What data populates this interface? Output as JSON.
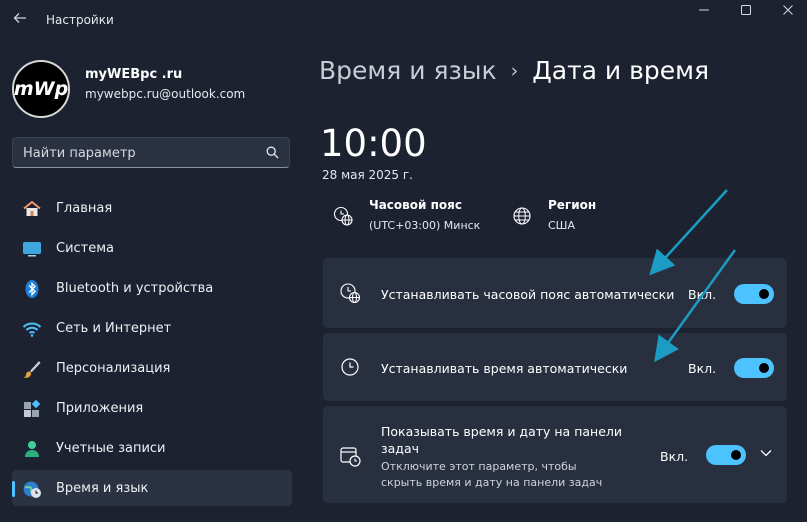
{
  "window": {
    "title": "Настройки",
    "controls": [
      "minimize-icon",
      "maximize-icon",
      "close-icon"
    ]
  },
  "profile": {
    "avatar_text": "mWp",
    "name": "myWEBpc .ru",
    "email": "mywebpc.ru@outlook.com"
  },
  "search": {
    "placeholder": "Найти параметр"
  },
  "sidebar": {
    "items": [
      {
        "label": "Главная",
        "icon": "home-icon",
        "active": false
      },
      {
        "label": "Система",
        "icon": "system-icon",
        "active": false
      },
      {
        "label": "Bluetooth и устройства",
        "icon": "bluetooth-icon",
        "active": false
      },
      {
        "label": "Сеть и Интернет",
        "icon": "wifi-icon",
        "active": false
      },
      {
        "label": "Персонализация",
        "icon": "brush-icon",
        "active": false
      },
      {
        "label": "Приложения",
        "icon": "apps-icon",
        "active": false
      },
      {
        "label": "Учетные записи",
        "icon": "account-icon",
        "active": false
      },
      {
        "label": "Время и язык",
        "icon": "time-language-icon",
        "active": true
      }
    ]
  },
  "breadcrumb": {
    "parent": "Время и язык",
    "separator": "›",
    "current": "Дата и время"
  },
  "clock": {
    "time": "10:00",
    "date": "28 мая 2025 г."
  },
  "timezone": {
    "title": "Часовой пояс",
    "value": "(UTC+03:00) Минск"
  },
  "region": {
    "title": "Регион",
    "value": "США"
  },
  "settings": [
    {
      "label": "Устанавливать часовой пояс автоматически",
      "state": "Вкл.",
      "on": true,
      "icon": "globe-clock-icon"
    },
    {
      "label": "Устанавливать время автоматически",
      "state": "Вкл.",
      "on": true,
      "icon": "clock-icon"
    },
    {
      "label": "Показывать время и дату на панели задач",
      "sub": "Отключите этот параметр, чтобы скрыть время и дату на панели задач",
      "state": "Вкл.",
      "on": true,
      "icon": "calendar-clock-icon"
    }
  ],
  "colors": {
    "accent": "#4cc2ff",
    "background": "#1c2230",
    "card": "#283040",
    "arrow": "#1a9cc4"
  }
}
